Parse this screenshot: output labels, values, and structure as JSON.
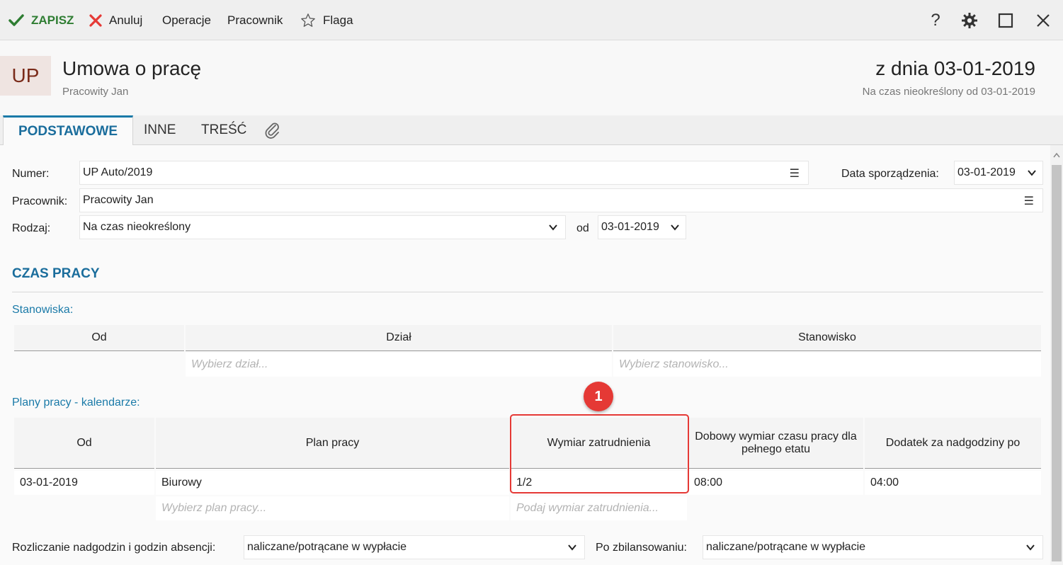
{
  "toolbar": {
    "save": "ZAPISZ",
    "cancel": "Anuluj",
    "operations": "Operacje",
    "employee": "Pracownik",
    "flag": "Flaga",
    "help": "?"
  },
  "header": {
    "badge": "UP",
    "title": "Umowa o pracę",
    "subtitle": "Pracowity Jan",
    "date": "z dnia 03-01-2019",
    "type": "Na czas nieokreślony od 03-01-2019"
  },
  "tabs": [
    "PODSTAWOWE",
    "INNE",
    "TREŚĆ"
  ],
  "form": {
    "numer_label": "Numer:",
    "numer_value": "UP Auto/2019",
    "data_label": "Data sporządzenia:",
    "data_value": "03-01-2019",
    "pracownik_label": "Pracownik:",
    "pracownik_value": "Pracowity Jan",
    "rodzaj_label": "Rodzaj:",
    "rodzaj_value": "Na czas nieokreślony",
    "od_label": "od",
    "od_value": "03-01-2019"
  },
  "section": {
    "title": "CZAS PRACY",
    "stanowiska_label": "Stanowiska:",
    "plany_label": "Plany pracy - kalendarze:"
  },
  "stanowiska": {
    "headers": [
      "Od",
      "Dział",
      "Stanowisko"
    ],
    "placeholders": [
      "Wybierz dział...",
      "Wybierz stanowisko..."
    ]
  },
  "plany": {
    "headers": [
      "Od",
      "Plan pracy",
      "Wymiar zatrudnienia",
      "Dobowy wymiar czasu pracy dla pełnego etatu",
      "Dodatek za nadgodziny po"
    ],
    "row": [
      "03-01-2019",
      "Biurowy",
      "1/2",
      "08:00",
      "04:00"
    ],
    "placeholders": [
      "Wybierz plan pracy...",
      "Podaj wymiar zatrudnienia..."
    ]
  },
  "bottom": {
    "rozliczanie_label": "Rozliczanie nadgodzin i godzin absencji:",
    "rozliczanie_value": "naliczane/potrącane w wypłacie",
    "po_label": "Po zbilansowaniu:",
    "po_value": "naliczane/potrącane w wypłacie"
  },
  "annotation": "1",
  "colors": {
    "accent": "#1a6d9c",
    "save": "#2e7d32",
    "cancel": "#e53935",
    "highlight": "#e53935"
  }
}
